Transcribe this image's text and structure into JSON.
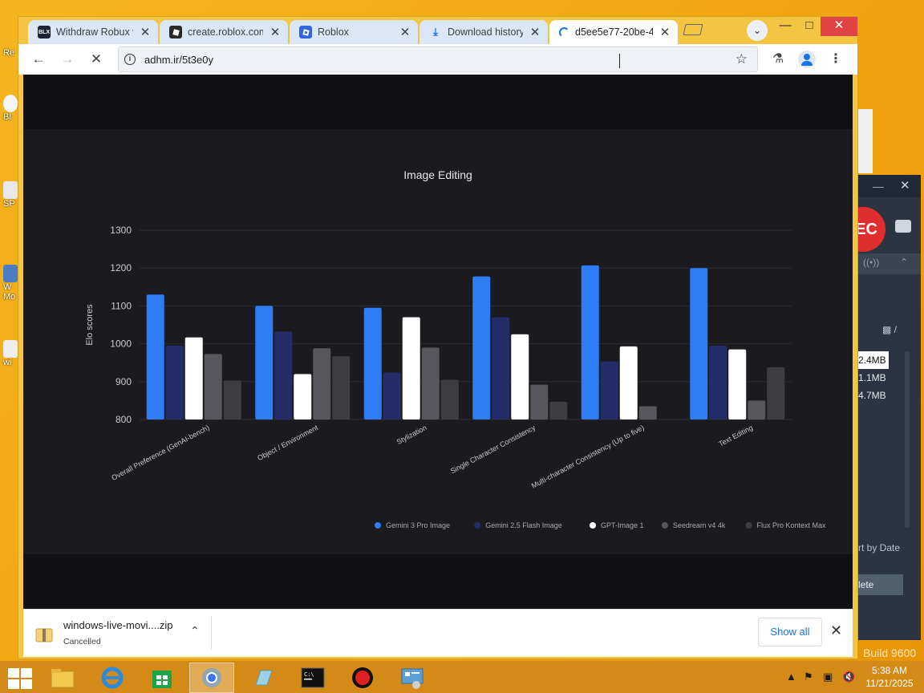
{
  "desktop": {
    "icon_labels": [
      "Re",
      "Bl",
      "SP",
      "W",
      "Mo",
      "wi"
    ]
  },
  "browser": {
    "tabs": [
      {
        "title": "Withdraw Robux v",
        "favicon": "blx-icon",
        "active": false
      },
      {
        "title": "create.roblox.com",
        "favicon": "roblox-studio-icon",
        "active": false
      },
      {
        "title": "Roblox",
        "favicon": "roblox-icon",
        "active": false
      },
      {
        "title": "Download history",
        "favicon": "download-icon",
        "active": false
      },
      {
        "title": "d5ee5e77-20be-4",
        "favicon": "loading-spinner-icon",
        "active": true
      }
    ],
    "url": "adhm.ir/5t3e0y",
    "accent_color": "#1a73e8"
  },
  "chart_data": {
    "type": "bar",
    "title": "Image Editing",
    "ylabel": "Elo scores",
    "xlabel": "",
    "ylim": [
      800,
      1300
    ],
    "yticks": [
      800,
      900,
      1000,
      1100,
      1200,
      1300
    ],
    "grid": true,
    "legend_position": "bottom-right",
    "categories": [
      "Overall Preference (GenAI-bench)",
      "Object / Environment",
      "Stylization",
      "Single Character Consistency",
      "Multi-character Consistency (Up to five)",
      "Text Editing"
    ],
    "series": [
      {
        "name": "Gemini 3 Pro Image",
        "color": "#2f7df6",
        "values": [
          1130,
          1100,
          1095,
          1178,
          1207,
          1200
        ]
      },
      {
        "name": "Gemini 2.5 Flash Image",
        "color": "#242c6a",
        "values": [
          995,
          1032,
          924,
          1070,
          953,
          995
        ]
      },
      {
        "name": "GPT-Image 1",
        "color": "#ffffff",
        "values": [
          1017,
          920,
          1070,
          1025,
          993,
          985
        ]
      },
      {
        "name": "Seedream v4 4k",
        "color": "#56565c",
        "values": [
          973,
          988,
          990,
          892,
          835,
          850
        ]
      },
      {
        "name": "Flux Pro Kontext Max",
        "color": "#3d3d42",
        "values": [
          903,
          967,
          905,
          847,
          null,
          938
        ]
      }
    ]
  },
  "downloads": {
    "file_name": "windows-live-movi....zip",
    "status": "Cancelled",
    "show_all_label": "Show all"
  },
  "recorder": {
    "rec_label": "EC",
    "file_sizes": [
      "2.4MB",
      "1.1MB",
      "4.7MB"
    ],
    "folder_slash": "/",
    "sort_label": "rt by Date",
    "delete_label": "lete"
  },
  "watermark": "Build 9600",
  "taskbar": {
    "time": "5:38 AM",
    "date": "11/21/2025"
  }
}
